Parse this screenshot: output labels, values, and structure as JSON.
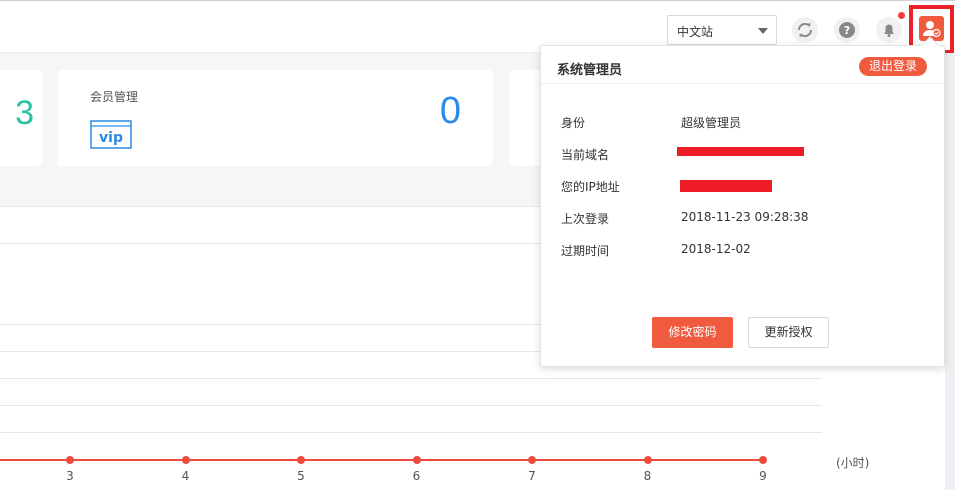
{
  "header": {
    "lang_select_value": "中文站",
    "icons": [
      "refresh-icon",
      "help-icon",
      "bell-icon",
      "user-icon"
    ],
    "accent_color": "#f05a3f"
  },
  "cards": [
    {
      "value": "3",
      "value_color": "#2cc1a6"
    },
    {
      "title": "会员管理",
      "icon": "vip-icon",
      "icon_text": "vip",
      "value": "0",
      "value_color": "#2b8ae8"
    }
  ],
  "chart_data": {
    "type": "line",
    "x": [
      3,
      4,
      5,
      6,
      7,
      8,
      9
    ],
    "xlabel": "(小时)",
    "series": [
      {
        "values": [
          0,
          0,
          0,
          0,
          0,
          0,
          0
        ],
        "color": "#f04a3c"
      }
    ],
    "grid": true
  },
  "popup": {
    "title": "系统管理员",
    "logout_label": "退出登录",
    "rows": [
      {
        "label": "身份",
        "value": "超级管理员"
      },
      {
        "label": "当前域名",
        "value": ""
      },
      {
        "label": "您的IP地址",
        "value": ""
      },
      {
        "label": "上次登录",
        "value": "2018-11-23 09:28:38"
      },
      {
        "label": "过期时间",
        "value": "2018-12-02"
      }
    ],
    "change_password_label": "修改密码",
    "renew_label": "更新授权"
  }
}
